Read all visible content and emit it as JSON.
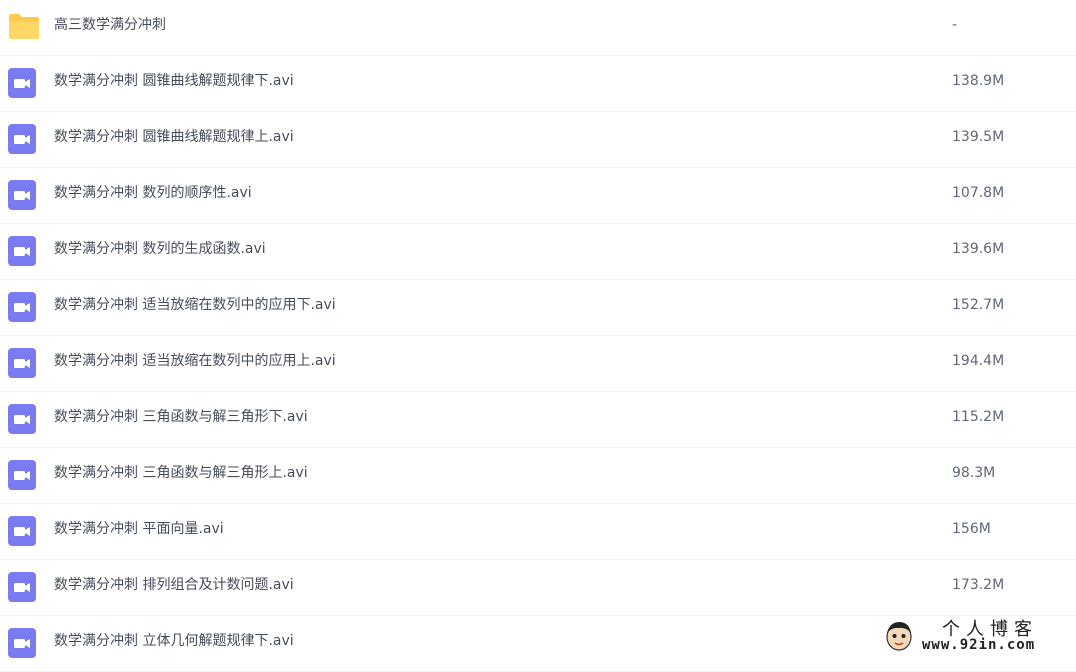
{
  "files": [
    {
      "name": "高三数学满分冲刺",
      "size": "-",
      "type": "folder",
      "icon": "folder-icon"
    },
    {
      "name": "数学满分冲刺 圆锥曲线解题规律下.avi",
      "size": "138.9M",
      "type": "video",
      "icon": "video-file-icon"
    },
    {
      "name": "数学满分冲刺 圆锥曲线解题规律上.avi",
      "size": "139.5M",
      "type": "video",
      "icon": "video-file-icon"
    },
    {
      "name": "数学满分冲刺 数列的顺序性.avi",
      "size": "107.8M",
      "type": "video",
      "icon": "video-file-icon"
    },
    {
      "name": "数学满分冲刺 数列的生成函数.avi",
      "size": "139.6M",
      "type": "video",
      "icon": "video-file-icon"
    },
    {
      "name": "数学满分冲刺 适当放缩在数列中的应用下.avi",
      "size": "152.7M",
      "type": "video",
      "icon": "video-file-icon"
    },
    {
      "name": "数学满分冲刺 适当放缩在数列中的应用上.avi",
      "size": "194.4M",
      "type": "video",
      "icon": "video-file-icon"
    },
    {
      "name": "数学满分冲刺 三角函数与解三角形下.avi",
      "size": "115.2M",
      "type": "video",
      "icon": "video-file-icon"
    },
    {
      "name": "数学满分冲刺 三角函数与解三角形上.avi",
      "size": "98.3M",
      "type": "video",
      "icon": "video-file-icon"
    },
    {
      "name": "数学满分冲刺 平面向量.avi",
      "size": "156M",
      "type": "video",
      "icon": "video-file-icon"
    },
    {
      "name": "数学满分冲刺 排列组合及计数问题.avi",
      "size": "173.2M",
      "type": "video",
      "icon": "video-file-icon"
    },
    {
      "name": "数学满分冲刺 立体几何解题规律下.avi",
      "size": "",
      "type": "video",
      "icon": "video-file-icon"
    }
  ],
  "watermark": {
    "title": "个人博客",
    "url": "www.92in.com"
  },
  "colors": {
    "folder": "#ffc94d",
    "video": "#7a7bf0",
    "text": "#454d5a",
    "size_text": "#5f6777",
    "divider": "#f1f2f4"
  }
}
